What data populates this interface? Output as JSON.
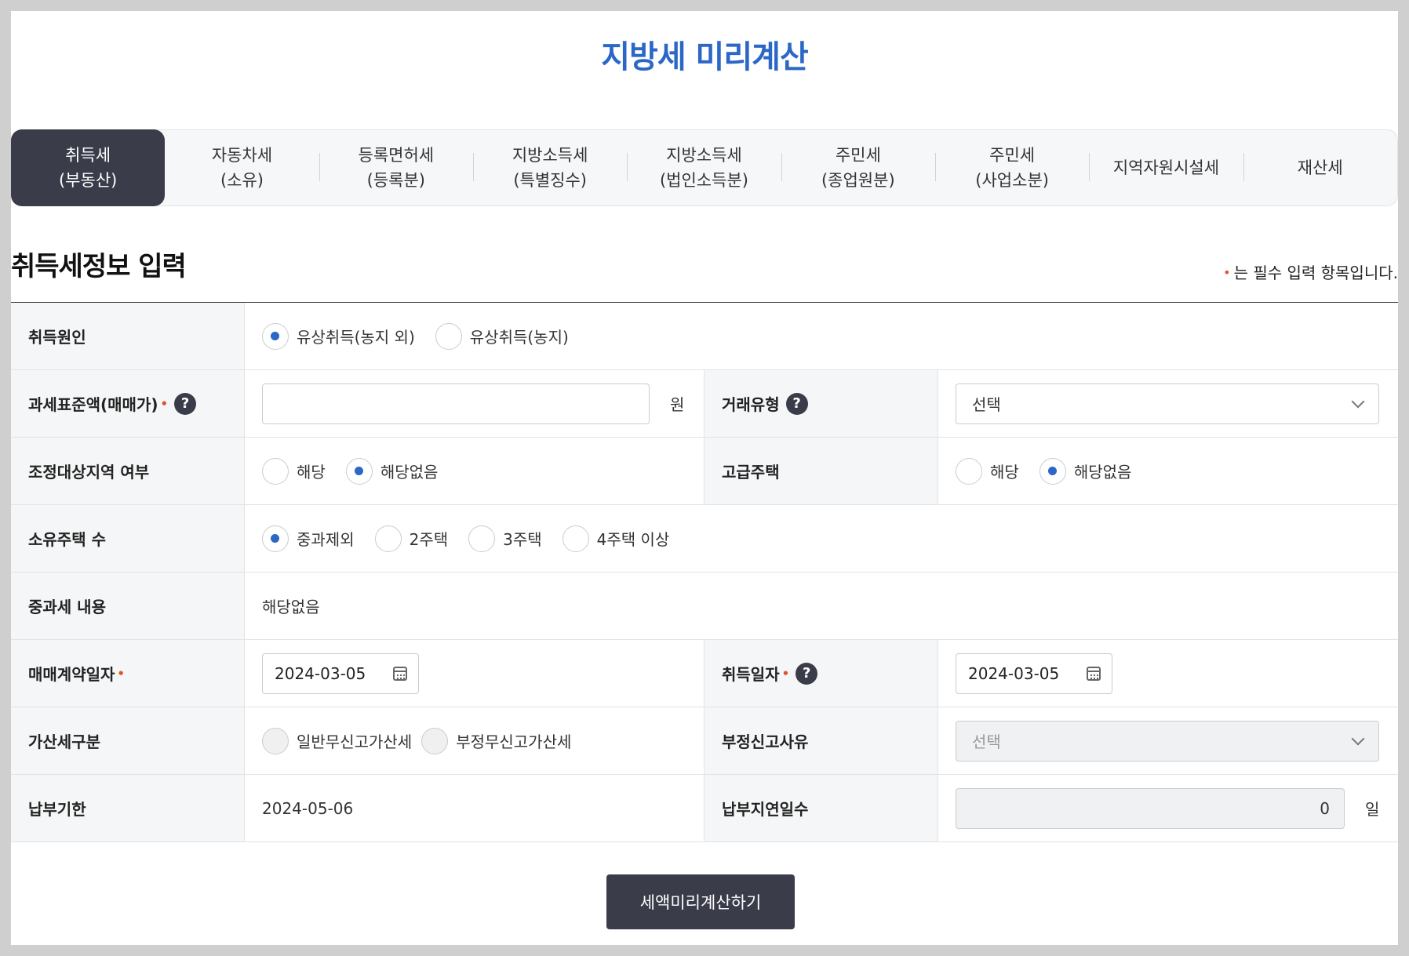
{
  "page_title": "지방세 미리계산",
  "tabs": [
    {
      "line1": "취득세",
      "line2": "(부동산)",
      "active": true
    },
    {
      "line1": "자동차세",
      "line2": "(소유)"
    },
    {
      "line1": "등록면허세",
      "line2": "(등록분)"
    },
    {
      "line1": "지방소득세",
      "line2": "(특별징수)"
    },
    {
      "line1": "지방소득세",
      "line2": "(법인소득분)"
    },
    {
      "line1": "주민세",
      "line2": "(종업원분)"
    },
    {
      "line1": "주민세",
      "line2": "(사업소분)"
    },
    {
      "line1": "지역자원시설세",
      "line2": ""
    },
    {
      "line1": "재산세",
      "line2": ""
    }
  ],
  "section": {
    "title": "취득세정보 입력",
    "required_note": "는 필수 입력 항목입니다."
  },
  "required_marker": "•",
  "form": {
    "acq_cause": {
      "label": "취득원인",
      "options": [
        {
          "label": "유상취득(농지 외)",
          "selected": true
        },
        {
          "label": "유상취득(농지)",
          "selected": false
        }
      ]
    },
    "tax_base": {
      "label": "과세표준액(매매가)",
      "value": "",
      "unit": "원"
    },
    "deal_type": {
      "label": "거래유형",
      "selected": "선택"
    },
    "adjust_area": {
      "label": "조정대상지역 여부",
      "options": [
        {
          "label": "해당",
          "selected": false
        },
        {
          "label": "해당없음",
          "selected": true
        }
      ]
    },
    "luxury_house": {
      "label": "고급주택",
      "options": [
        {
          "label": "해당",
          "selected": false
        },
        {
          "label": "해당없음",
          "selected": true
        }
      ]
    },
    "house_count": {
      "label": "소유주택 수",
      "options": [
        {
          "label": "중과제외",
          "selected": true
        },
        {
          "label": "2주택",
          "selected": false
        },
        {
          "label": "3주택",
          "selected": false
        },
        {
          "label": "4주택 이상",
          "selected": false
        }
      ]
    },
    "heavy_tax": {
      "label": "중과세 내용",
      "value": "해당없음"
    },
    "contract_date": {
      "label": "매매계약일자",
      "value": "2024-03-05"
    },
    "acq_date": {
      "label": "취득일자",
      "value": "2024-03-05"
    },
    "penalty_type": {
      "label": "가산세구분",
      "options": [
        {
          "label": "일반무신고가산세",
          "selected": false
        },
        {
          "label": "부정무신고가산세",
          "selected": false
        }
      ]
    },
    "fraud_reason": {
      "label": "부정신고사유",
      "selected": "선택"
    },
    "due_date": {
      "label": "납부기한",
      "value": "2024-05-06"
    },
    "delay_days": {
      "label": "납부지연일수",
      "value": "0",
      "unit": "일"
    }
  },
  "help_glyph": "?",
  "calc_button": "세액미리계산하기",
  "colors": {
    "accent": "#2b67c6",
    "dark": "#3a3c4a",
    "required": "#e0532c"
  }
}
